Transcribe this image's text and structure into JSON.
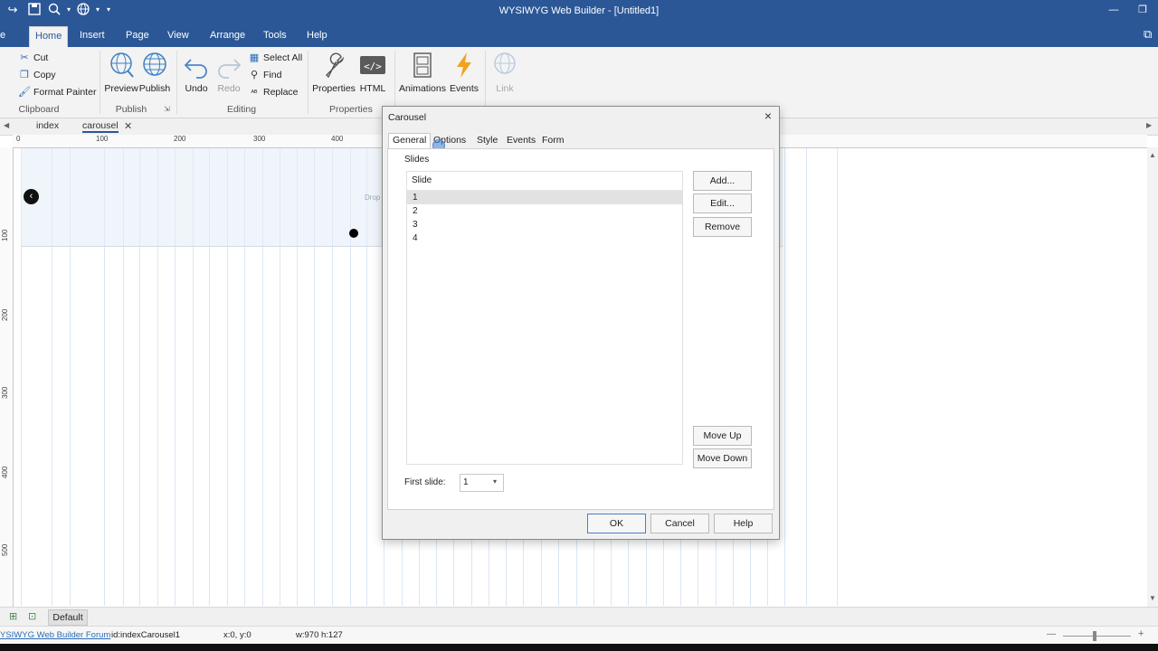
{
  "app": {
    "title": "WYSIWYG Web Builder - [Untitled1]"
  },
  "ribbon_tabs": [
    {
      "label": "e"
    },
    {
      "label": "Home"
    },
    {
      "label": "Insert"
    },
    {
      "label": "Page"
    },
    {
      "label": "View"
    },
    {
      "label": "Arrange"
    },
    {
      "label": "Tools"
    },
    {
      "label": "Help"
    }
  ],
  "clipboard": {
    "cut": "Cut",
    "copy": "Copy",
    "format_painter": "Format Painter",
    "label": "Clipboard"
  },
  "publish": {
    "preview": "Preview",
    "publish": "Publish",
    "label": "Publish"
  },
  "editing": {
    "undo": "Undo",
    "redo": "Redo",
    "select_all": "Select All",
    "find": "Find",
    "replace": "Replace",
    "label": "Editing"
  },
  "properties_group": {
    "properties": "Properties",
    "html": "HTML",
    "label": "Properties"
  },
  "other_buttons": {
    "animations": "Animations",
    "events": "Events",
    "link": "Link"
  },
  "doc_tabs": [
    {
      "label": "index"
    },
    {
      "label": "carousel"
    }
  ],
  "ruler": {
    "h": [
      "0",
      "100",
      "200",
      "300",
      "400"
    ],
    "v": [
      "100",
      "200",
      "300",
      "400",
      "500"
    ]
  },
  "canvas": {
    "drop_text": "Drop"
  },
  "dialog": {
    "title": "Carousel",
    "close": "×",
    "tabs": [
      "General",
      "Options",
      "Style",
      "Events",
      "Form"
    ],
    "section": "Slides",
    "column": "Slide",
    "slides": [
      "1",
      "2",
      "3",
      "4"
    ],
    "buttons": {
      "add": "Add...",
      "edit": "Edit...",
      "remove": "Remove",
      "move_up": "Move Up",
      "move_down": "Move Down"
    },
    "first_slide_label": "First slide:",
    "first_slide_value": "1",
    "ok": "OK",
    "cancel": "Cancel",
    "help": "Help"
  },
  "bottombar": {
    "layer": "Default"
  },
  "status": {
    "forum": "YSIWYG Web Builder Forum",
    "id": "id:indexCarousel1",
    "coords": "x:0, y:0",
    "size": "w:970 h:127"
  },
  "colors": {
    "accent": "#2b5797",
    "grid": "#dbe7f3"
  }
}
